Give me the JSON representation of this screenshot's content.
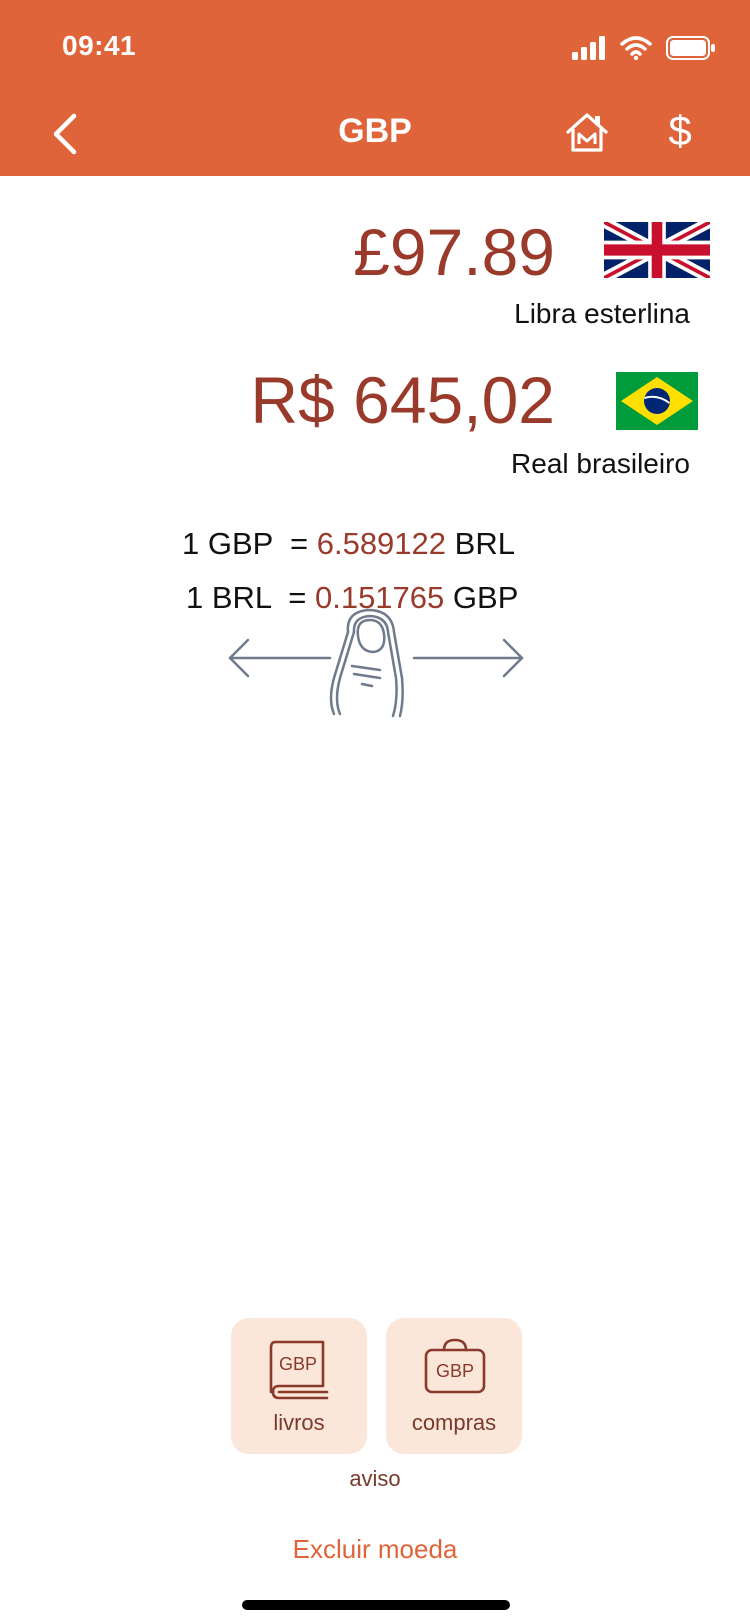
{
  "status_bar": {
    "time": "09:41"
  },
  "nav": {
    "title": "GBP",
    "dollar_label": "$"
  },
  "amounts": {
    "gbp_amount": "£97.89",
    "gbp_name": "Libra esterlina",
    "brl_amount": "R$ 645,02",
    "brl_name": "Real brasileiro"
  },
  "rates": {
    "r1_left": "1 GBP  =",
    "r1_value": "6.589122",
    "r1_unit": "BRL",
    "r2_left": "1 BRL  =",
    "r2_value": "0.151765",
    "r2_unit": "GBP"
  },
  "tiles": {
    "books_icon_text": "GBP",
    "books_label": "livros",
    "shop_icon_text": "GBP",
    "shop_label": "compras"
  },
  "aviso": "aviso",
  "delete_label": "Excluir moeda",
  "colors": {
    "header": "#E0643A",
    "amount_text": "#9A3A2A",
    "tile_bg": "#FBE6DA",
    "delete_text": "#E0643A"
  },
  "icons": {
    "back": "chevron-left-icon",
    "home": "home-icon",
    "dollar": "dollar-icon",
    "flag_gbp": "uk-flag-icon",
    "flag_brl": "brazil-flag-icon",
    "swipe": "swipe-hand-icon",
    "books": "book-icon",
    "shop": "shopping-bag-icon"
  }
}
